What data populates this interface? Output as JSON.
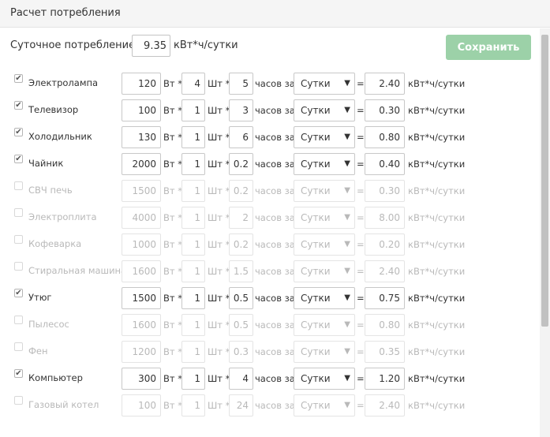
{
  "header": {
    "title": "Расчет потребления"
  },
  "summary": {
    "label": "Суточное потребление:",
    "value": "9.35",
    "unit": "кВт*ч/сутки"
  },
  "save_button": {
    "label": "Сохранить"
  },
  "labels": {
    "power_unit": "Вт *",
    "qty_unit": "Шт *",
    "hours_unit": "часов за",
    "equals": "=",
    "result_unit": "кВт*ч/сутки",
    "check_mark": "✔",
    "dropdown_arrow": "▼"
  },
  "appliances": [
    {
      "name": "Электролампа",
      "enabled": true,
      "power": "120",
      "qty": "4",
      "hours": "5",
      "period": "Сутки",
      "result": "2.40"
    },
    {
      "name": "Телевизор",
      "enabled": true,
      "power": "100",
      "qty": "1",
      "hours": "3",
      "period": "Сутки",
      "result": "0.30"
    },
    {
      "name": "Холодильник",
      "enabled": true,
      "power": "130",
      "qty": "1",
      "hours": "6",
      "period": "Сутки",
      "result": "0.80"
    },
    {
      "name": "Чайник",
      "enabled": true,
      "power": "2000",
      "qty": "1",
      "hours": "0.2",
      "period": "Сутки",
      "result": "0.40"
    },
    {
      "name": "СВЧ печь",
      "enabled": false,
      "power": "1500",
      "qty": "1",
      "hours": "0.2",
      "period": "Сутки",
      "result": "0.30"
    },
    {
      "name": "Электроплита",
      "enabled": false,
      "power": "4000",
      "qty": "1",
      "hours": "2",
      "period": "Сутки",
      "result": "8.00"
    },
    {
      "name": "Кофеварка",
      "enabled": false,
      "power": "1000",
      "qty": "1",
      "hours": "0.2",
      "period": "Сутки",
      "result": "0.20"
    },
    {
      "name": "Стиральная машина",
      "enabled": false,
      "power": "1600",
      "qty": "1",
      "hours": "1.5",
      "period": "Сутки",
      "result": "2.40"
    },
    {
      "name": "Утюг",
      "enabled": true,
      "power": "1500",
      "qty": "1",
      "hours": "0.5",
      "period": "Сутки",
      "result": "0.75"
    },
    {
      "name": "Пылесос",
      "enabled": false,
      "power": "1600",
      "qty": "1",
      "hours": "0.5",
      "period": "Сутки",
      "result": "0.80"
    },
    {
      "name": "Фен",
      "enabled": false,
      "power": "1200",
      "qty": "1",
      "hours": "0.3",
      "period": "Сутки",
      "result": "0.35"
    },
    {
      "name": "Компьютер",
      "enabled": true,
      "power": "300",
      "qty": "1",
      "hours": "4",
      "period": "Сутки",
      "result": "1.20"
    },
    {
      "name": "Газовый котел",
      "enabled": false,
      "power": "100",
      "qty": "1",
      "hours": "24",
      "period": "Сутки",
      "result": "2.40"
    }
  ]
}
